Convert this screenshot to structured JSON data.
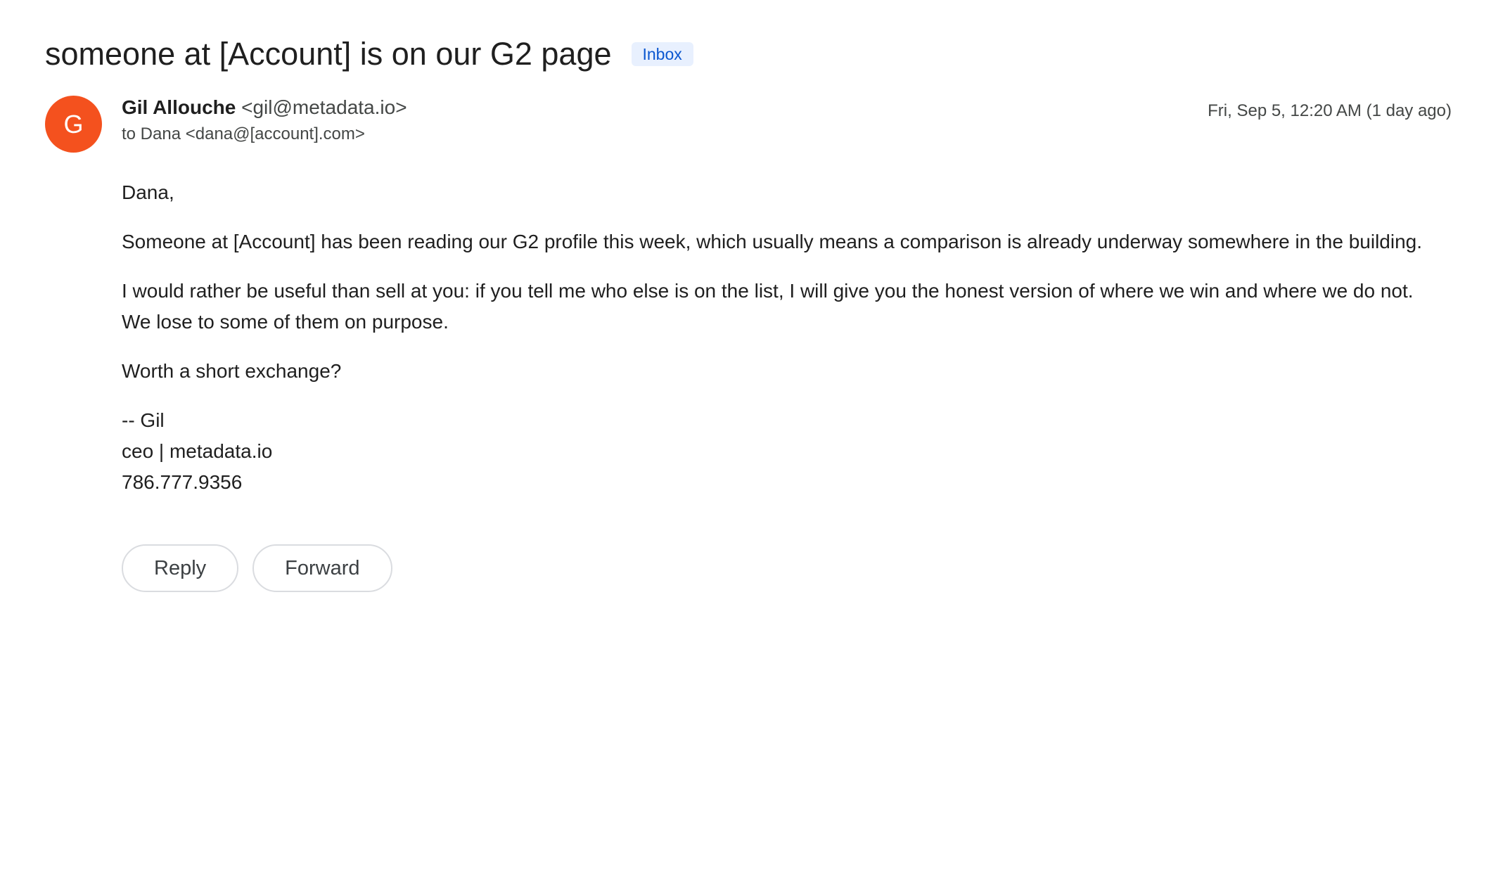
{
  "email": {
    "subject": "someone at [Account] is on our G2 page",
    "label": "Inbox",
    "avatar_letter": "G",
    "avatar_color": "#f4511e",
    "sender_name": "Gil Allouche",
    "sender_email": "<gil@metadata.io>",
    "recipient": "to Dana <dana@[account].com>",
    "timestamp": "Fri, Sep 5, 12:20 AM (1 day ago)",
    "body": {
      "greeting": "Dana,",
      "paragraphs": [
        "Someone at [Account] has been reading our G2 profile this week, which usually means a comparison is already underway somewhere in the building.",
        "I would rather be useful than sell at you: if you tell me who else is on the list, I will give you the honest version of where we win and where we do not. We lose to some of them on purpose.",
        "Worth a short exchange?"
      ],
      "signature": [
        "-- Gil",
        "ceo | metadata.io",
        "786.777.9356"
      ]
    },
    "actions": {
      "reply_label": "Reply",
      "forward_label": "Forward"
    }
  }
}
